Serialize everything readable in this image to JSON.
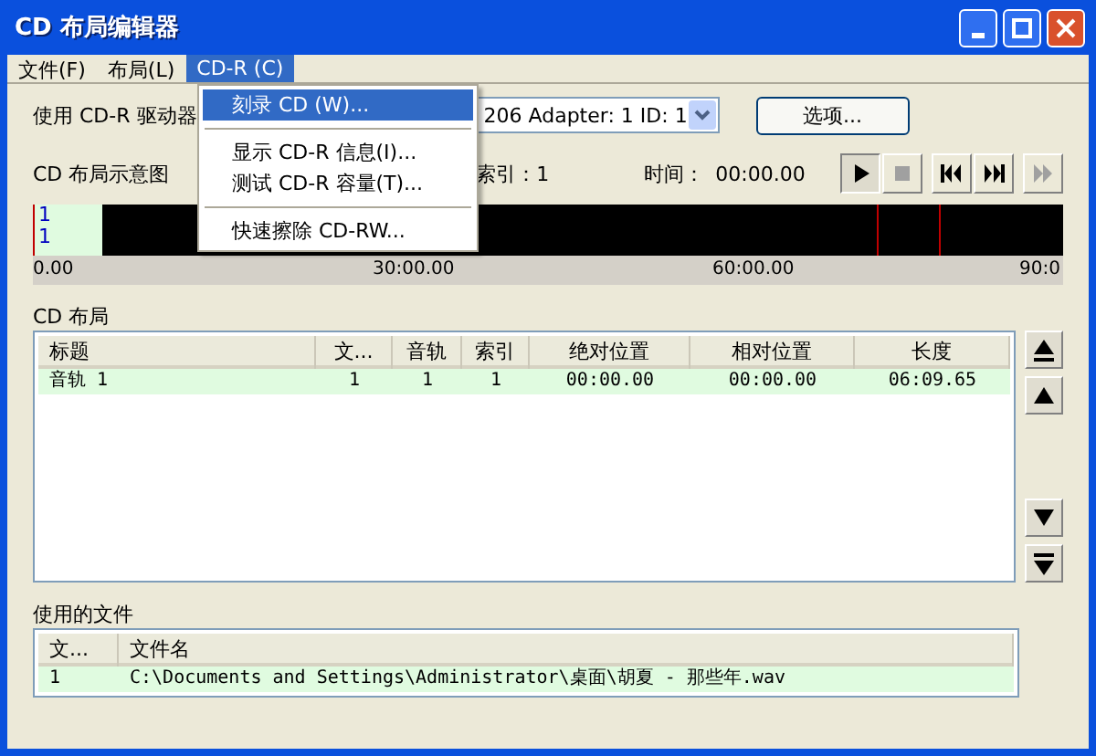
{
  "window": {
    "title": "CD 布局编辑器"
  },
  "menu": [
    {
      "label": "文件(F)",
      "selected": false
    },
    {
      "label": "布局(L)",
      "selected": false
    },
    {
      "label": "CD-R (C)",
      "selected": true
    }
  ],
  "dropdown": [
    {
      "kind": "item",
      "label": "刻录 CD (W)...",
      "selected": true
    },
    {
      "kind": "separator"
    },
    {
      "kind": "item",
      "label": "显示 CD-R 信息(I)...",
      "selected": false
    },
    {
      "kind": "item",
      "label": "测试 CD-R 容量(T)...",
      "selected": false
    },
    {
      "kind": "separator"
    },
    {
      "kind": "item",
      "label": "快速擦除 CD-RW...",
      "selected": false
    }
  ],
  "drive": {
    "label": "使用 CD-R 驱动器",
    "value": "206  Adapter: 1  ID: 1",
    "options_button": "选项..."
  },
  "layout_view": {
    "label": "CD 布局示意图",
    "index": "索引：1",
    "time_label": "时间：",
    "time_value": "00:00.00"
  },
  "transport": [
    {
      "kind": "play",
      "selected": true,
      "disabled": false
    },
    {
      "kind": "stop",
      "selected": false,
      "disabled": true
    },
    {
      "kind": "prev",
      "selected": false,
      "disabled": false
    },
    {
      "kind": "next",
      "selected": false,
      "disabled": false
    },
    {
      "kind": "forward",
      "selected": false,
      "disabled": true
    }
  ],
  "timeline": {
    "track_marks": [
      "1",
      "1"
    ],
    "ruler_labels": [
      "0.00",
      "30:00.00",
      "60:00.00",
      "90:0"
    ]
  },
  "layout_table": {
    "label": "CD 布局",
    "columns": [
      "标题",
      "文...",
      "音轨",
      "索引",
      "绝对位置",
      "相对位置",
      "长度"
    ],
    "rows": [
      {
        "cells": [
          "音轨 1",
          "1",
          "1",
          "1",
          "00:00.00",
          "00:00.00",
          "06:09.65"
        ],
        "selected": true
      }
    ]
  },
  "files_table": {
    "label": "使用的文件",
    "columns": [
      "文...",
      "文件名"
    ],
    "rows": [
      {
        "cells": [
          "1",
          "C:\\Documents and Settings\\Administrator\\桌面\\胡夏 - 那些年.wav"
        ],
        "selected": true
      }
    ]
  }
}
